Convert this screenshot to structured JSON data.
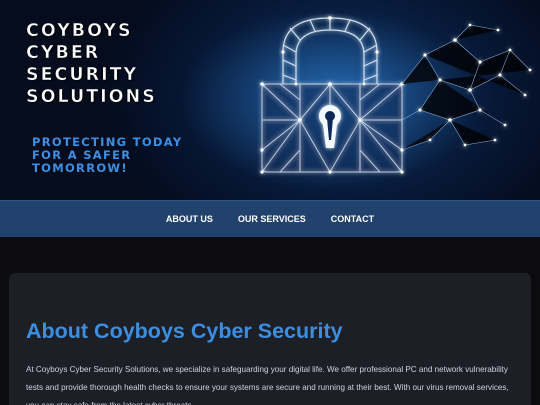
{
  "hero": {
    "title_lines": [
      "Coyboys",
      "Cyber",
      "Security",
      "Solutions"
    ],
    "tagline_lines": [
      "Protecting Today",
      "for a Safer",
      "Tomorrow!"
    ],
    "image": "glowing-padlock-network-illustration"
  },
  "nav": {
    "items": [
      {
        "label": "About Us"
      },
      {
        "label": "Our Services"
      },
      {
        "label": "Contact"
      }
    ]
  },
  "about": {
    "title": "About Coyboys Cyber Security",
    "body": "At Coyboys Cyber Security Solutions, we specialize in safeguarding your digital life. We offer professional PC and network vulnerability tests and provide thorough health checks to ensure your systems are secure and running at their best. With our virus removal services, you can stay safe from the latest cyber threats."
  },
  "colors": {
    "accent": "#3c8ee0",
    "nav_bg": "#22426e",
    "page_bg": "#0c0c0e",
    "card_bg": "#1d1f27",
    "hero_bg": "#061531"
  }
}
